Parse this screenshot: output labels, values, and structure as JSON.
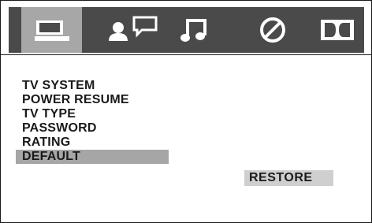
{
  "tabs": [
    {
      "icon": "tv-monitor-icon",
      "active": true
    },
    {
      "icon": "person-speech-icon",
      "active": false
    },
    {
      "icon": "music-note-icon",
      "active": false
    },
    {
      "icon": "no-entry-icon",
      "active": false
    },
    {
      "icon": "dolby-icon",
      "active": false
    }
  ],
  "menu": {
    "items": [
      {
        "label": "TV SYSTEM"
      },
      {
        "label": "POWER RESUME"
      },
      {
        "label": "TV TYPE"
      },
      {
        "label": "PASSWORD"
      },
      {
        "label": "RATING"
      },
      {
        "label": "DEFAULT",
        "selected": true
      }
    ]
  },
  "value": {
    "label": "RESTORE"
  },
  "colors": {
    "tabbar": "#4a4a4a",
    "active_tab": "#a7a7a7",
    "selected_row": "#a6a6a6",
    "value_bg": "#cfcfcf",
    "text": "#1a1a1a"
  }
}
